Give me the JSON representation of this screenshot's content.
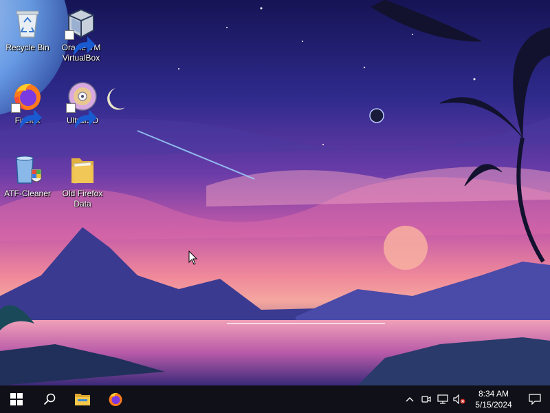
{
  "desktop": {
    "icons": [
      {
        "label": "Recycle Bin",
        "icon": "recycle-bin-icon",
        "shortcut": false
      },
      {
        "label": "Oracle VM\nVirtualBox",
        "icon": "virtualbox-icon",
        "shortcut": true
      },
      {
        "label": "Firefox",
        "icon": "firefox-icon",
        "shortcut": true
      },
      {
        "label": "UltraISO",
        "icon": "ultraiso-disc-icon",
        "shortcut": true
      },
      {
        "label": "ATF-Cleaner",
        "icon": "atf-cleaner-icon",
        "shortcut": false
      },
      {
        "label": "Old Firefox\nData",
        "icon": "folder-icon",
        "shortcut": false
      }
    ]
  },
  "taskbar": {
    "start": {
      "icon": "windows-logo-icon"
    },
    "search": {
      "icon": "search-icon"
    },
    "pinned": [
      {
        "icon": "file-explorer-icon"
      },
      {
        "icon": "firefox-icon"
      }
    ],
    "tray": {
      "icons": [
        "chevron-up-icon",
        "meet-now-icon",
        "network-icon",
        "volume-muted-icon"
      ],
      "time": "8:34 AM",
      "date": "5/15/2024",
      "notification_icon": "notification-center-icon"
    }
  },
  "colors": {
    "sky_top": "#1e1a6a",
    "sky_mid": "#6a3ca8",
    "horizon": "#f08a9a",
    "taskbar": "#101018",
    "folder_yellow": "#f0c54f"
  }
}
